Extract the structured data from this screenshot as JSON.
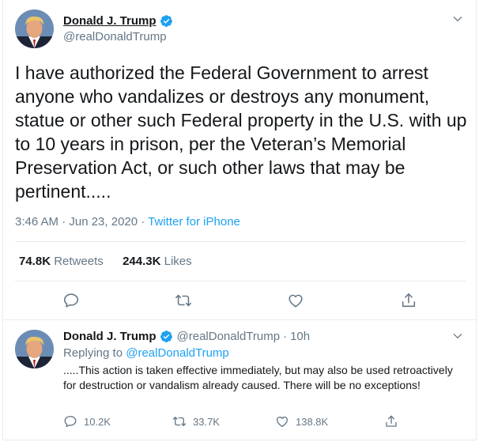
{
  "main_tweet": {
    "author": {
      "name": "Donald J. Trump",
      "handle": "@realDonaldTrump",
      "verified": true
    },
    "text": "I have authorized the Federal Government to arrest anyone who vandalizes or destroys any monument, statue or other such Federal property in the U.S. with up to 10 years in prison, per the Veteran’s Memorial Preservation Act, or such other laws that may be pertinent.....",
    "timestamp": "3:46 AM · Jun 23, 2020",
    "separator": " · ",
    "source": "Twitter for iPhone",
    "stats": {
      "retweets_count": "74.8K",
      "retweets_label": "Retweets",
      "likes_count": "244.3K",
      "likes_label": "Likes"
    },
    "icons": {
      "reply": "comment-icon",
      "retweet": "retweet-icon",
      "like": "heart-icon",
      "share": "share-icon",
      "menu": "chevron-down-icon",
      "verified": "verified-badge-icon"
    }
  },
  "reply_tweet": {
    "author": {
      "name": "Donald J. Trump",
      "handle": "@realDonaldTrump",
      "verified": true
    },
    "dot": "·",
    "time": "10h",
    "replying_to_label": "Replying to",
    "replying_to_handle": "@realDonaldTrump",
    "text": ".....This action is taken effective immediately, but may also be used retroactively for destruction or vandalism already caused. There will be no exceptions!",
    "actions": {
      "replies": "10.2K",
      "retweets": "33.7K",
      "likes": "138.8K"
    }
  },
  "colors": {
    "accent": "#1da1f2",
    "text_primary": "#14171a",
    "text_secondary": "#657786",
    "divider": "#e6ecf0"
  }
}
